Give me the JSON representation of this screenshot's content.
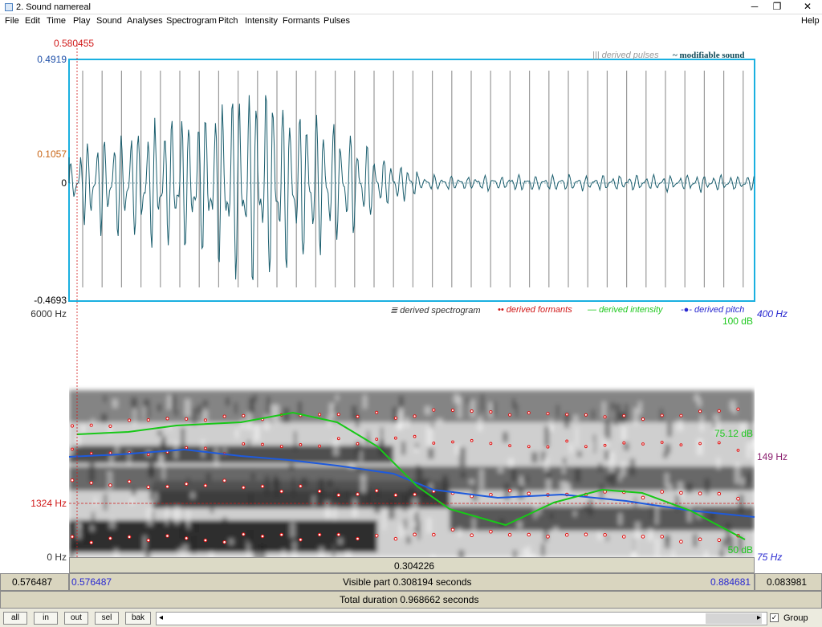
{
  "window": {
    "title": "2. Sound namereal",
    "min": "─",
    "max": "❐",
    "close": "✕"
  },
  "menu": [
    "File",
    "Edit",
    "Time",
    "Play",
    "Sound",
    "Analyses",
    "Spectrogram",
    "Pitch",
    "Intensity",
    "Formants",
    "Pulses"
  ],
  "help": "Help",
  "cursor_time": "0.580455",
  "wave": {
    "ymax": "0.4919",
    "ymid": "0.1057",
    "yzero": "0",
    "ymin": "-0.4693"
  },
  "wave_legend": {
    "pulses": "derived pulses",
    "pulses_glyph": "|||",
    "sound": "modifiable sound",
    "sound_glyph": "~"
  },
  "spec_legend": {
    "spectrogram": "derived spectrogram",
    "formants": "derived formants",
    "intensity": "derived intensity",
    "pitch": "derived pitch"
  },
  "spec": {
    "ftop": "6000 Hz",
    "fcursor": "1324 Hz",
    "fbottom": "0 Hz"
  },
  "intensity": {
    "top": "100 dB",
    "value": "75.12 dB",
    "bottom": "50 dB"
  },
  "pitch": {
    "top": "400 Hz",
    "value": "149 Hz",
    "bottom": "75 Hz"
  },
  "selection_len": "0.304226",
  "bar1": {
    "left": "0.576487",
    "start": "0.576487",
    "visible": "Visible part 0.308194 seconds",
    "end": "0.884681",
    "right": "0.083981"
  },
  "bar2": {
    "total": "Total duration 0.968662 seconds"
  },
  "buttons": {
    "all": "all",
    "in": "in",
    "out": "out",
    "sel": "sel",
    "bak": "bak"
  },
  "scroll_left": "◂",
  "scroll_right": "▸",
  "group": {
    "label": "Group",
    "checked": true,
    "mark": "✓"
  },
  "colors": {
    "wave": "#1b5e6e",
    "pitch": "#1e5adc",
    "intensity": "#18c818",
    "formant": "#e01010",
    "cursor": "#d01818",
    "frame": "#1ab0e0"
  }
}
